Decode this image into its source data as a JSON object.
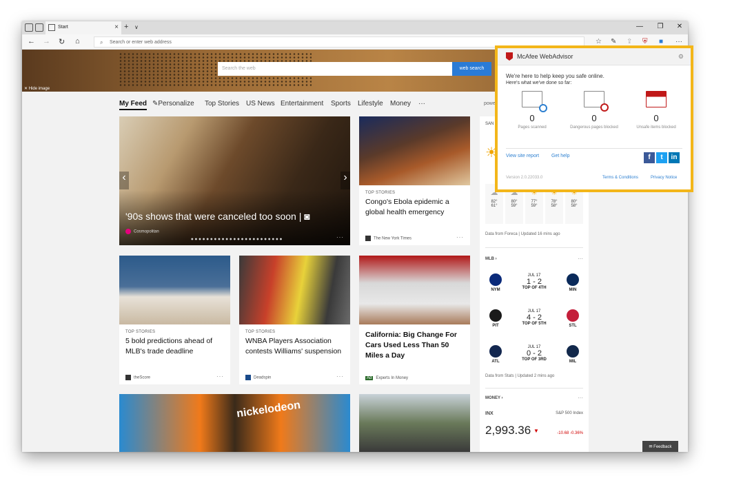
{
  "browser": {
    "tab_title": "Start",
    "address_placeholder": "Search or enter web address",
    "window_controls": [
      "—",
      "❐",
      "✕"
    ]
  },
  "hero": {
    "hide_image": "Hide image",
    "search_placeholder": "Search the web",
    "search_button": "web search"
  },
  "feed_nav": {
    "items": [
      "My Feed",
      "Personalize",
      "Top Stories",
      "US News",
      "Entertainment",
      "Sports",
      "Lifestyle",
      "Money",
      "···"
    ],
    "active": "My Feed",
    "powered": "powe"
  },
  "cards": [
    {
      "title": "'90s shows that were canceled too soon",
      "source": "Cosmopolitan"
    },
    {
      "category": "TOP STORIES",
      "title": "Congo's Ebola epidemic a global health emergency",
      "source": "The New York Times"
    },
    {
      "category": "TOP STORIES",
      "title": "5 bold predictions ahead of MLB's trade deadline",
      "source": "theScore"
    },
    {
      "category": "TOP STORIES",
      "title": "WNBA Players Association contests Williams' suspension",
      "source": "Deadspin"
    },
    {
      "title": "California: Big Change For Cars Used Less Than 50 Miles a Day",
      "source": "Experts In Money",
      "ad_label": "Ad"
    },
    {
      "image_text": "nickelodeon"
    },
    {}
  ],
  "weather": {
    "location": "SAN",
    "forecast": [
      {
        "hi": "82°",
        "lo": "61°"
      },
      {
        "hi": "80°",
        "lo": "59°"
      },
      {
        "hi": "77°",
        "lo": "59°"
      },
      {
        "hi": "78°",
        "lo": "58°"
      },
      {
        "hi": "80°",
        "lo": "58°"
      }
    ],
    "source": "Data from Foreca | Updated 16 mins ago"
  },
  "mlb": {
    "title": "MLB ›",
    "games": [
      {
        "away": "NYM",
        "home": "MIN",
        "date": "JUL 17",
        "score": "1 - 2",
        "status": "TOP OF 4TH"
      },
      {
        "away": "PIT",
        "home": "STL",
        "date": "JUL 17",
        "score": "4 - 2",
        "status": "TOP OF 5TH"
      },
      {
        "away": "ATL",
        "home": "MIL",
        "date": "JUL 17",
        "score": "0 - 2",
        "status": "TOP OF 3RD"
      }
    ],
    "source": "Data from Stats | Updated 2 mins ago"
  },
  "money": {
    "title": "MONEY ›",
    "symbol": "INX",
    "index_name": "S&P 500 Index",
    "value": "2,993.36",
    "change": "-10.68  -0.36%"
  },
  "mcafee": {
    "title": "McAfee WebAdvisor",
    "tagline": "We're here to help keep you safe online.",
    "subline": "Here's what we've done so far:",
    "stats": [
      {
        "value": "0",
        "label": "Pages scanned"
      },
      {
        "value": "0",
        "label": "Dangerous pages blocked"
      },
      {
        "value": "0",
        "label": "Unsafe items blocked"
      }
    ],
    "link_report": "View site report",
    "link_help": "Get help",
    "version": "Version 2.0.22033.0",
    "terms": "Terms & Conditions",
    "privacy": "Privacy Notice"
  },
  "feedback": "Feedback",
  "colors": {
    "accent": "#2a7bd6",
    "mcafee_border": "#f3b619",
    "mcafee_red": "#c01818",
    "loss_red": "#d00000"
  }
}
